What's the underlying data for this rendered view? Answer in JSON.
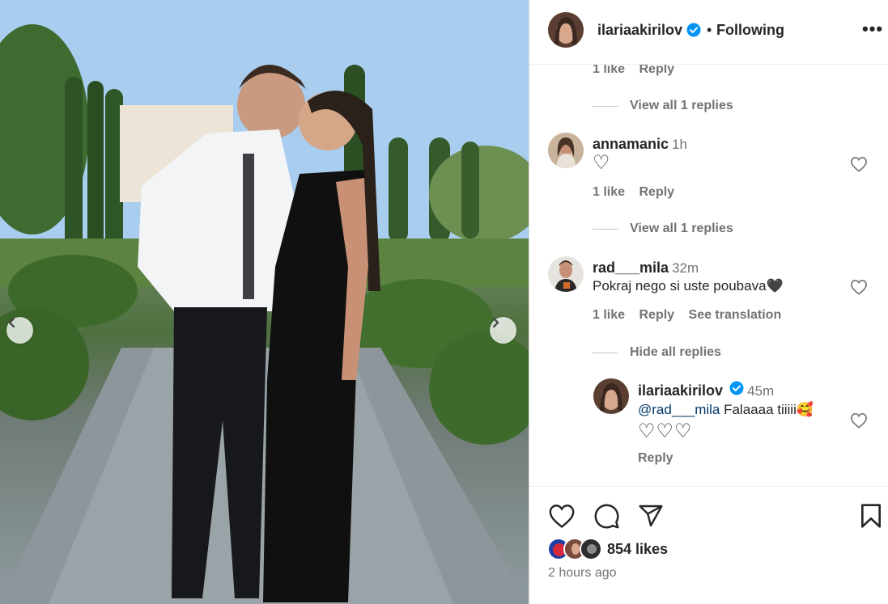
{
  "post": {
    "author": "ilariaakirilov",
    "follow_separator": "•",
    "follow_state": "Following",
    "more_label": "•••",
    "likes": "854 likes",
    "time_ago": "2 hours ago"
  },
  "comments": {
    "top_fragment": {
      "likes": "1 like",
      "reply": "Reply",
      "view_replies": "View all 1 replies"
    },
    "items": [
      {
        "username": "annamanic",
        "time": "1h",
        "text": "♡",
        "likes": "1 like",
        "reply": "Reply",
        "view_replies": "View all 1 replies"
      },
      {
        "username": "rad___mila",
        "time": "32m",
        "text": "Pokraj nego si uste poubava🖤",
        "likes": "1 like",
        "reply": "Reply",
        "translate": "See translation",
        "hide_replies": "Hide all replies",
        "reply_item": {
          "username": "ilariaakirilov",
          "time": "45m",
          "mention": "@rad___mila",
          "text": " Falaaaa tiiiii🥰",
          "text_line2": "♡♡♡",
          "reply": "Reply"
        }
      }
    ]
  },
  "colors": {
    "verified": "#0095f6",
    "text_primary": "#262626",
    "text_secondary": "#737373",
    "mention": "#00376b"
  },
  "icons": [
    "heart-icon",
    "comment-icon",
    "share-icon",
    "bookmark-icon",
    "chevron-left-icon",
    "chevron-right-icon",
    "verified-badge-icon",
    "more-options-icon"
  ]
}
